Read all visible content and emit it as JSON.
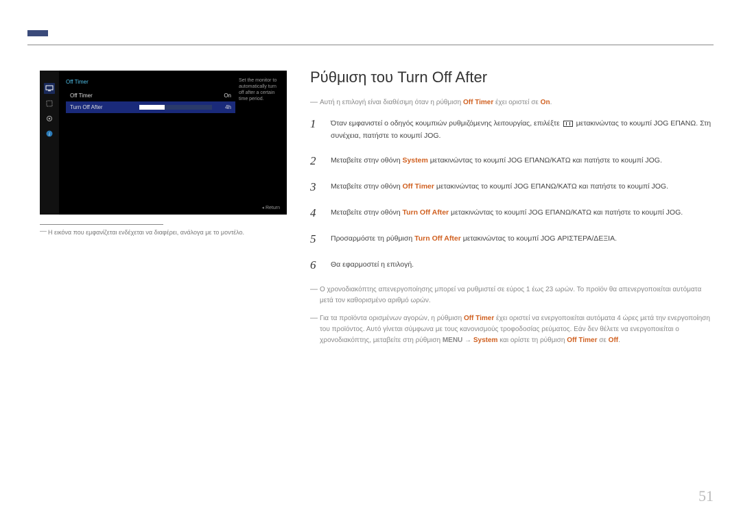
{
  "page_number": "51",
  "screenshot": {
    "title": "Off Timer",
    "row1_label": "Off Timer",
    "row1_value": "On",
    "row2_label": "Turn Off After",
    "row2_value": "4h",
    "desc": "Set the monitor to automatically turn off after a certain time period.",
    "return": "Return"
  },
  "caption": "Η εικόνα που εμφανίζεται ενδέχεται να διαφέρει, ανάλογα με το μοντέλο.",
  "heading": "Ρύθμιση του Turn Off After",
  "subnote_pre": "Αυτή η επιλογή είναι διαθέσιμη όταν η ρύθμιση ",
  "subnote_accent1": "Off Timer",
  "subnote_mid": " έχει οριστεί σε ",
  "subnote_accent2": "On",
  "subnote_post": ".",
  "steps": {
    "s1a": "Όταν εμφανιστεί ο οδηγός κουμπιών ρυθμιζόμενης λειτουργίας, επιλέξτε ",
    "s1b": " μετακινώντας το κουμπί JOG ΕΠΑΝΩ. Στη συνέχεια, πατήστε το κουμπί JOG.",
    "s2a": "Μεταβείτε στην οθόνη ",
    "s2accent": "System",
    "s2b": " μετακινώντας το κουμπί JOG ΕΠΑΝΩ/ΚΑΤΩ και πατήστε το κουμπί JOG.",
    "s3a": "Μεταβείτε στην οθόνη ",
    "s3accent": "Off Timer",
    "s3b": " μετακινώντας το κουμπί JOG ΕΠΑΝΩ/ΚΑΤΩ και πατήστε το κουμπί JOG.",
    "s4a": "Μεταβείτε στην οθόνη ",
    "s4accent": "Turn Off After",
    "s4b": " μετακινώντας το κουμπί JOG ΕΠΑΝΩ/ΚΑΤΩ και πατήστε το κουμπί JOG.",
    "s5a": "Προσαρμόστε τη ρύθμιση ",
    "s5accent": "Turn Off After",
    "s5b": " μετακινώντας το κουμπί JOG ΑΡΙΣΤΕΡΑ/ΔΕΞΙΑ.",
    "s6": "Θα εφαρμοστεί η επιλογή."
  },
  "footnotes": {
    "f1": "Ο χρονοδιακόπτης απενεργοποίησης μπορεί να ρυθμιστεί σε εύρος 1 έως 23 ωρών. Το προϊόν θα απενεργοποιείται αυτόματα μετά τον καθορισμένο αριθμό ωρών.",
    "f2a": "Για τα προϊόντα ορισμένων αγορών, η ρύθμιση ",
    "f2accent1": "Off Timer",
    "f2b": " έχει οριστεί να ενεργοποιείται αυτόματα 4 ώρες μετά την ενεργοποίηση του προϊόντος. Αυτό γίνεται σύμφωνα με τους κανονισμούς τροφοδοσίας ρεύματος. Εάν δεν θέλετε να ενεργοποιείται ο χρονοδιακόπτης, μεταβείτε στη ρύθμιση ",
    "f2menu": "MENU",
    "f2arrow": " → ",
    "f2accent2": "System",
    "f2c": " και ορίστε τη ρύθμιση ",
    "f2accent3": "Off Timer",
    "f2d": " σε ",
    "f2accent4": "Off",
    "f2e": "."
  }
}
